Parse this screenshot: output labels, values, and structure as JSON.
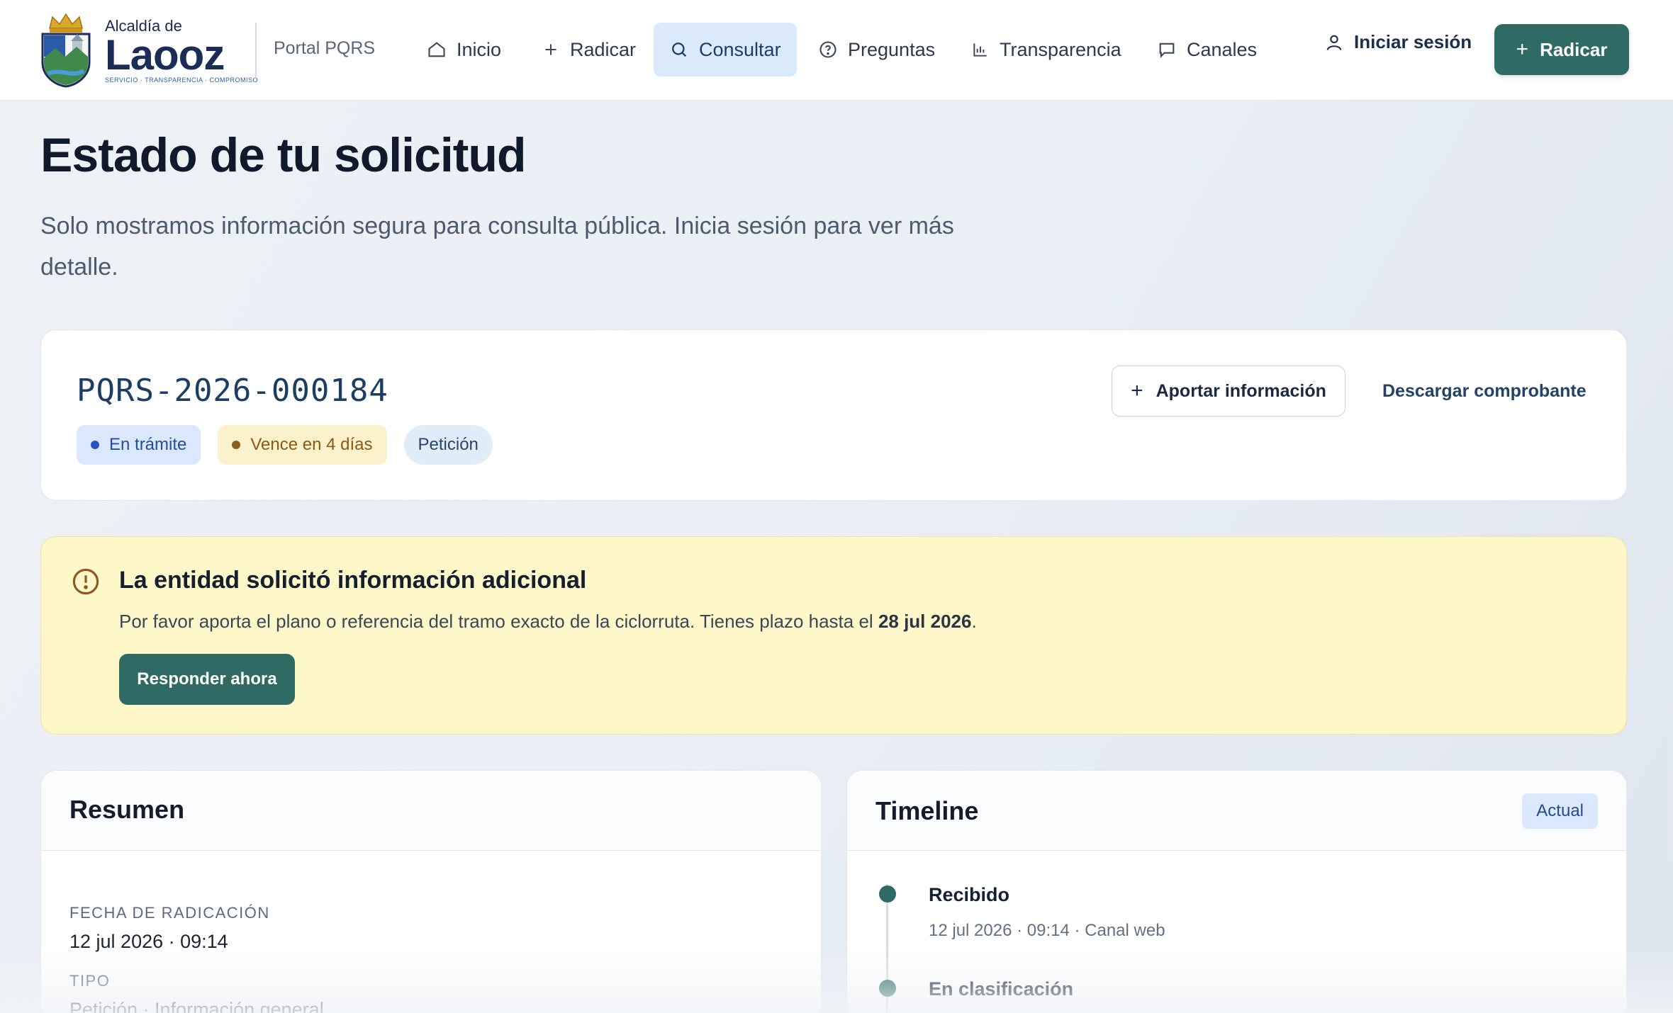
{
  "header": {
    "brand_small": "Alcaldía de",
    "brand_big": "Laooz",
    "brand_tag": "SERVICIO · TRANSPARENCIA · COMPROMISO",
    "portal_name": "Portal PQRS",
    "nav": [
      {
        "label": "Inicio",
        "icon": "home-icon"
      },
      {
        "label": "Radicar",
        "icon": "plus-icon"
      },
      {
        "label": "Consultar",
        "icon": "search-icon"
      },
      {
        "label": "Preguntas",
        "icon": "help-circle-icon"
      },
      {
        "label": "Transparencia",
        "icon": "bar-chart-icon"
      },
      {
        "label": "Canales",
        "icon": "chat-icon"
      }
    ],
    "login_label": "Iniciar sesión",
    "radicar_button": "Radicar"
  },
  "page": {
    "title": "Estado de tu solicitud",
    "subtitle": "Solo mostramos información segura para consulta pública. Inicia sesión para ver más detalle."
  },
  "case": {
    "code": "PQRS-2026-000184",
    "status_badge": "En trámite",
    "due_badge": "Vence en 4 días",
    "type_badge": "Petición",
    "aportar_button": "Aportar información",
    "download_link": "Descargar comprobante"
  },
  "alert": {
    "title": "La entidad solicitó información adicional",
    "text_prefix": "Por favor aporta el plano o referencia del tramo exacto de la ciclorruta. Tienes plazo hasta el ",
    "deadline": "28 jul 2026",
    "text_suffix": ".",
    "button": "Responder ahora"
  },
  "resumen": {
    "title": "Resumen",
    "fields": [
      {
        "label": "FECHA DE RADICACIÓN",
        "value": "12 jul 2026 · 09:14"
      },
      {
        "label": "TIPO",
        "value": "Petición · Información general"
      }
    ]
  },
  "timeline": {
    "title": "Timeline",
    "badge": "Actual",
    "events": [
      {
        "title": "Recibido",
        "meta": "12 jul 2026 · 09:14 · Canal web"
      },
      {
        "title": "En clasificación",
        "meta": ""
      }
    ]
  },
  "colors": {
    "primary": "#2f6b64",
    "accent_blue": "#dbeafa",
    "alert_bg": "#fdf7c9"
  }
}
